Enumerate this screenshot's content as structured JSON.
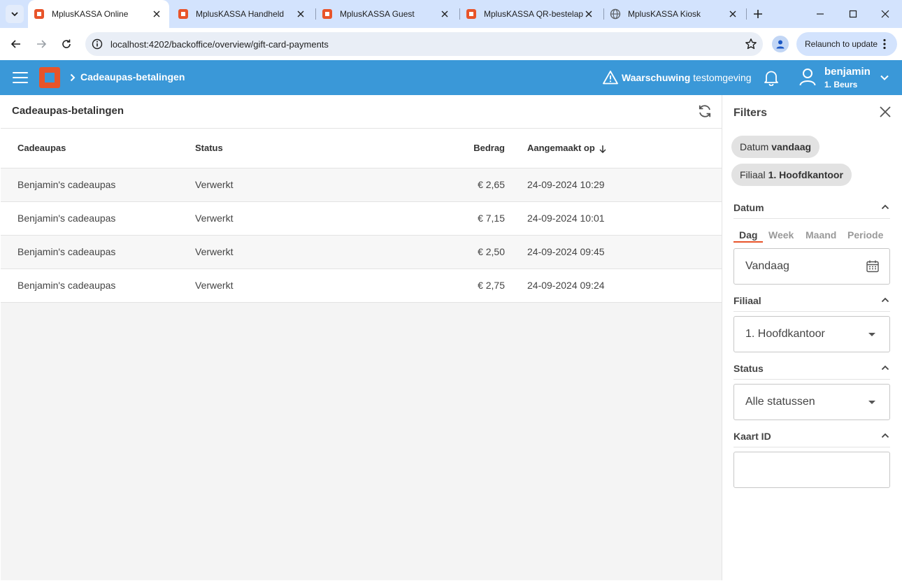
{
  "browser": {
    "tabs": [
      {
        "title": "MplusKASSA Online",
        "active": true
      },
      {
        "title": "MplusKASSA Handheld",
        "active": false
      },
      {
        "title": "MplusKASSA Guest",
        "active": false
      },
      {
        "title": "MplusKASSA QR-bestelapp",
        "active": false
      },
      {
        "title": "MplusKASSA Kiosk",
        "active": false
      }
    ],
    "url": "localhost:4202/backoffice/overview/gift-card-payments",
    "relaunch_label": "Relaunch to update"
  },
  "app": {
    "breadcrumb": "Cadeaupas-betalingen",
    "warning_bold": "Waarschuwing",
    "warning_text": "testomgeving",
    "user_name": "benjamin",
    "user_branch": "1. Beurs",
    "colors": {
      "header": "#3a98d8",
      "brand": "#e8542a"
    }
  },
  "main": {
    "title": "Cadeaupas-betalingen",
    "columns": [
      "Cadeaupas",
      "Status",
      "Bedrag",
      "Aangemaakt op"
    ],
    "sort": {
      "column": "Aangemaakt op",
      "direction": "desc"
    },
    "rows": [
      {
        "card": "Benjamin's cadeaupas",
        "status": "Verwerkt",
        "amount": "€ 2,65",
        "created": "24-09-2024 10:29"
      },
      {
        "card": "Benjamin's cadeaupas",
        "status": "Verwerkt",
        "amount": "€ 7,15",
        "created": "24-09-2024 10:01"
      },
      {
        "card": "Benjamin's cadeaupas",
        "status": "Verwerkt",
        "amount": "€ 2,50",
        "created": "24-09-2024 09:45"
      },
      {
        "card": "Benjamin's cadeaupas",
        "status": "Verwerkt",
        "amount": "€ 2,75",
        "created": "24-09-2024 09:24"
      }
    ]
  },
  "filters": {
    "title": "Filters",
    "chips": [
      {
        "label": "Datum",
        "value": "vandaag"
      },
      {
        "label": "Filiaal",
        "value": "1. Hoofdkantoor"
      }
    ],
    "datum": {
      "label": "Datum",
      "tabs": [
        "Dag",
        "Week",
        "Maand",
        "Periode"
      ],
      "active_tab": "Dag",
      "value": "Vandaag"
    },
    "filiaal": {
      "label": "Filiaal",
      "value": "1. Hoofdkantoor"
    },
    "status": {
      "label": "Status",
      "value": "Alle statussen"
    },
    "kaart_id": {
      "label": "Kaart ID",
      "value": ""
    }
  }
}
